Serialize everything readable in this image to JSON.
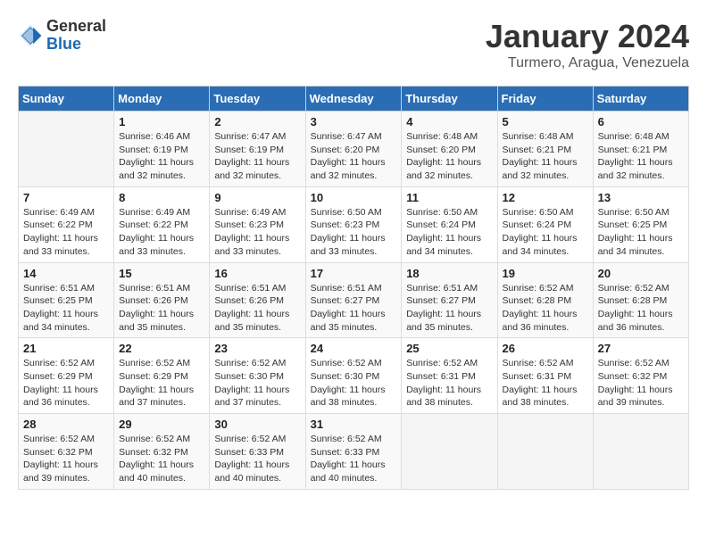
{
  "header": {
    "logo_general": "General",
    "logo_blue": "Blue",
    "title": "January 2024",
    "subtitle": "Turmero, Aragua, Venezuela"
  },
  "weekdays": [
    "Sunday",
    "Monday",
    "Tuesday",
    "Wednesday",
    "Thursday",
    "Friday",
    "Saturday"
  ],
  "weeks": [
    [
      {
        "day": "",
        "info": ""
      },
      {
        "day": "1",
        "info": "Sunrise: 6:46 AM\nSunset: 6:19 PM\nDaylight: 11 hours\nand 32 minutes."
      },
      {
        "day": "2",
        "info": "Sunrise: 6:47 AM\nSunset: 6:19 PM\nDaylight: 11 hours\nand 32 minutes."
      },
      {
        "day": "3",
        "info": "Sunrise: 6:47 AM\nSunset: 6:20 PM\nDaylight: 11 hours\nand 32 minutes."
      },
      {
        "day": "4",
        "info": "Sunrise: 6:48 AM\nSunset: 6:20 PM\nDaylight: 11 hours\nand 32 minutes."
      },
      {
        "day": "5",
        "info": "Sunrise: 6:48 AM\nSunset: 6:21 PM\nDaylight: 11 hours\nand 32 minutes."
      },
      {
        "day": "6",
        "info": "Sunrise: 6:48 AM\nSunset: 6:21 PM\nDaylight: 11 hours\nand 32 minutes."
      }
    ],
    [
      {
        "day": "7",
        "info": "Sunrise: 6:49 AM\nSunset: 6:22 PM\nDaylight: 11 hours\nand 33 minutes."
      },
      {
        "day": "8",
        "info": "Sunrise: 6:49 AM\nSunset: 6:22 PM\nDaylight: 11 hours\nand 33 minutes."
      },
      {
        "day": "9",
        "info": "Sunrise: 6:49 AM\nSunset: 6:23 PM\nDaylight: 11 hours\nand 33 minutes."
      },
      {
        "day": "10",
        "info": "Sunrise: 6:50 AM\nSunset: 6:23 PM\nDaylight: 11 hours\nand 33 minutes."
      },
      {
        "day": "11",
        "info": "Sunrise: 6:50 AM\nSunset: 6:24 PM\nDaylight: 11 hours\nand 34 minutes."
      },
      {
        "day": "12",
        "info": "Sunrise: 6:50 AM\nSunset: 6:24 PM\nDaylight: 11 hours\nand 34 minutes."
      },
      {
        "day": "13",
        "info": "Sunrise: 6:50 AM\nSunset: 6:25 PM\nDaylight: 11 hours\nand 34 minutes."
      }
    ],
    [
      {
        "day": "14",
        "info": "Sunrise: 6:51 AM\nSunset: 6:25 PM\nDaylight: 11 hours\nand 34 minutes."
      },
      {
        "day": "15",
        "info": "Sunrise: 6:51 AM\nSunset: 6:26 PM\nDaylight: 11 hours\nand 35 minutes."
      },
      {
        "day": "16",
        "info": "Sunrise: 6:51 AM\nSunset: 6:26 PM\nDaylight: 11 hours\nand 35 minutes."
      },
      {
        "day": "17",
        "info": "Sunrise: 6:51 AM\nSunset: 6:27 PM\nDaylight: 11 hours\nand 35 minutes."
      },
      {
        "day": "18",
        "info": "Sunrise: 6:51 AM\nSunset: 6:27 PM\nDaylight: 11 hours\nand 35 minutes."
      },
      {
        "day": "19",
        "info": "Sunrise: 6:52 AM\nSunset: 6:28 PM\nDaylight: 11 hours\nand 36 minutes."
      },
      {
        "day": "20",
        "info": "Sunrise: 6:52 AM\nSunset: 6:28 PM\nDaylight: 11 hours\nand 36 minutes."
      }
    ],
    [
      {
        "day": "21",
        "info": "Sunrise: 6:52 AM\nSunset: 6:29 PM\nDaylight: 11 hours\nand 36 minutes."
      },
      {
        "day": "22",
        "info": "Sunrise: 6:52 AM\nSunset: 6:29 PM\nDaylight: 11 hours\nand 37 minutes."
      },
      {
        "day": "23",
        "info": "Sunrise: 6:52 AM\nSunset: 6:30 PM\nDaylight: 11 hours\nand 37 minutes."
      },
      {
        "day": "24",
        "info": "Sunrise: 6:52 AM\nSunset: 6:30 PM\nDaylight: 11 hours\nand 38 minutes."
      },
      {
        "day": "25",
        "info": "Sunrise: 6:52 AM\nSunset: 6:31 PM\nDaylight: 11 hours\nand 38 minutes."
      },
      {
        "day": "26",
        "info": "Sunrise: 6:52 AM\nSunset: 6:31 PM\nDaylight: 11 hours\nand 38 minutes."
      },
      {
        "day": "27",
        "info": "Sunrise: 6:52 AM\nSunset: 6:32 PM\nDaylight: 11 hours\nand 39 minutes."
      }
    ],
    [
      {
        "day": "28",
        "info": "Sunrise: 6:52 AM\nSunset: 6:32 PM\nDaylight: 11 hours\nand 39 minutes."
      },
      {
        "day": "29",
        "info": "Sunrise: 6:52 AM\nSunset: 6:32 PM\nDaylight: 11 hours\nand 40 minutes."
      },
      {
        "day": "30",
        "info": "Sunrise: 6:52 AM\nSunset: 6:33 PM\nDaylight: 11 hours\nand 40 minutes."
      },
      {
        "day": "31",
        "info": "Sunrise: 6:52 AM\nSunset: 6:33 PM\nDaylight: 11 hours\nand 40 minutes."
      },
      {
        "day": "",
        "info": ""
      },
      {
        "day": "",
        "info": ""
      },
      {
        "day": "",
        "info": ""
      }
    ]
  ]
}
